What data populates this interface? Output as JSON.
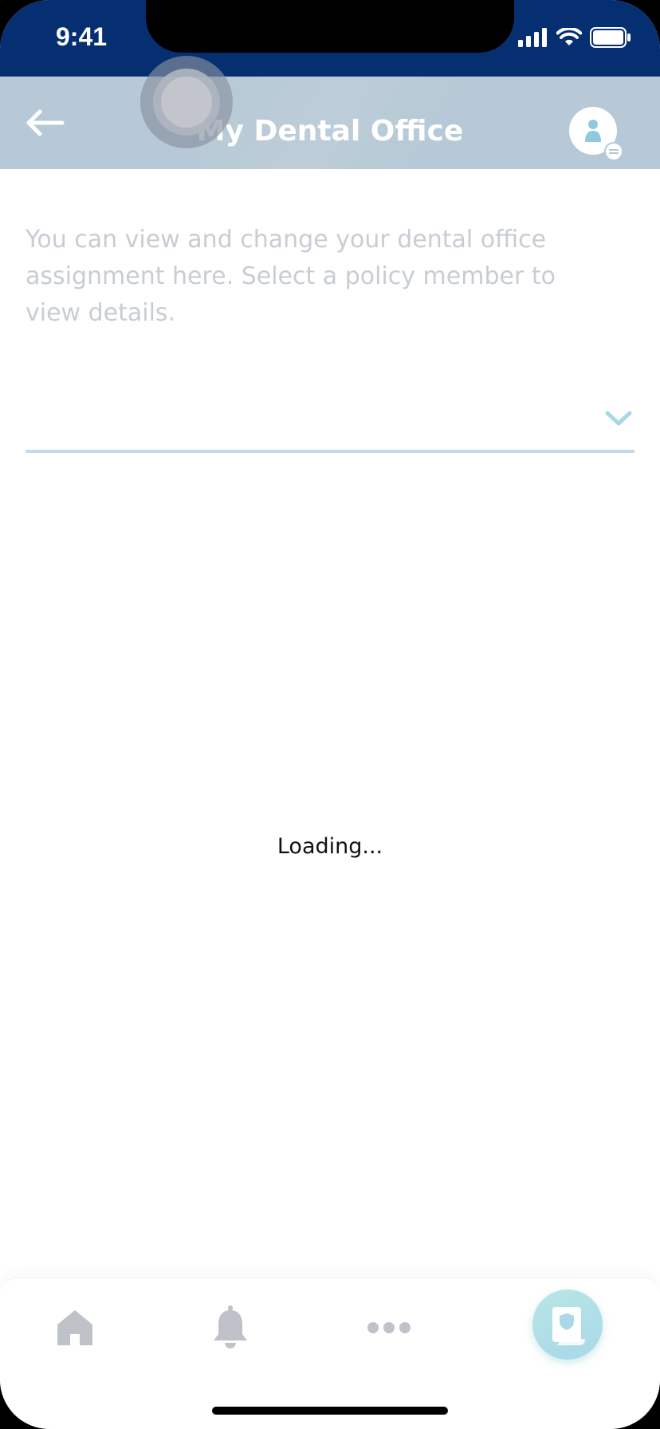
{
  "status_bar": {
    "time": "9:41",
    "icons": [
      "signal-icon",
      "wifi-icon",
      "battery-icon"
    ]
  },
  "header": {
    "title": "My Dental Office",
    "back_icon": "arrow-left-icon",
    "profile_icon": "profile-menu-icon"
  },
  "content": {
    "description": "You can view and change your dental office assignment here. Select a policy member to view details.",
    "member_select_value": "",
    "loading_text": "Loading..."
  },
  "bottom_nav": {
    "items": [
      {
        "name": "home",
        "icon": "home-icon"
      },
      {
        "name": "notifications",
        "icon": "bell-icon"
      },
      {
        "name": "more",
        "icon": "more-icon"
      },
      {
        "name": "policy",
        "icon": "policy-shield-icon",
        "active": true
      }
    ]
  },
  "colors": {
    "status_bar": "#062F72",
    "header": "#B7C9D6",
    "select_underline": "#BEDCEA",
    "active_nav": "#B7E6E6"
  }
}
